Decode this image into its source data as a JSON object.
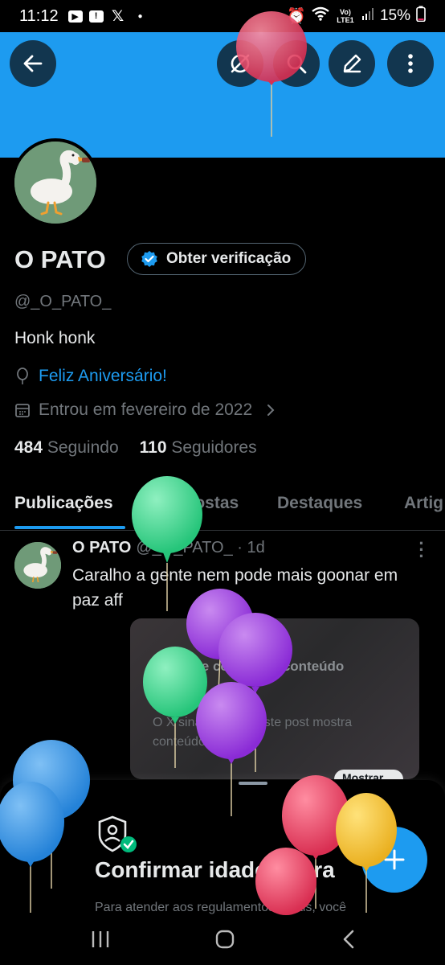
{
  "status_bar": {
    "time": "11:12",
    "battery": "15%",
    "net_label": "Vo) LTE1"
  },
  "profile": {
    "name": "O PATO",
    "verify_label": "Obter verificação",
    "handle": "@_O_PATO_",
    "bio": "Honk honk",
    "birthday": "Feliz Aniversário!",
    "joined": "Entrou em fevereiro de 2022",
    "following_count": "484",
    "following_label": "Seguindo",
    "followers_count": "110",
    "followers_label": "Seguidores"
  },
  "tabs": [
    {
      "label": "Publicações",
      "active": true
    },
    {
      "label": "Respostas",
      "active": false
    },
    {
      "label": "Destaques",
      "active": false
    },
    {
      "label": "Artig",
      "active": false
    }
  ],
  "post": {
    "author": "O PATO",
    "meta": "@_O_PATO_ · 1d",
    "text": "Caralho a gente nem pode mais goonar em paz aff",
    "media_title": "Aviso de conteúdo: conteúdo sensível",
    "media_desc": "O X sinalizou que este post mostra conteúdo sensível.",
    "media_button": "Mostrar"
  },
  "sheet": {
    "title": "Confirmar idade agora",
    "body": "Para atender aos regulamentos legais, você"
  },
  "colors": {
    "accent": "#1d9bf0",
    "balloon_red": "#e8435f",
    "balloon_green": "#3fd98e",
    "balloon_purple": "#9b3de0",
    "balloon_blue": "#2f8fe0",
    "balloon_yellow": "#f2c230"
  }
}
